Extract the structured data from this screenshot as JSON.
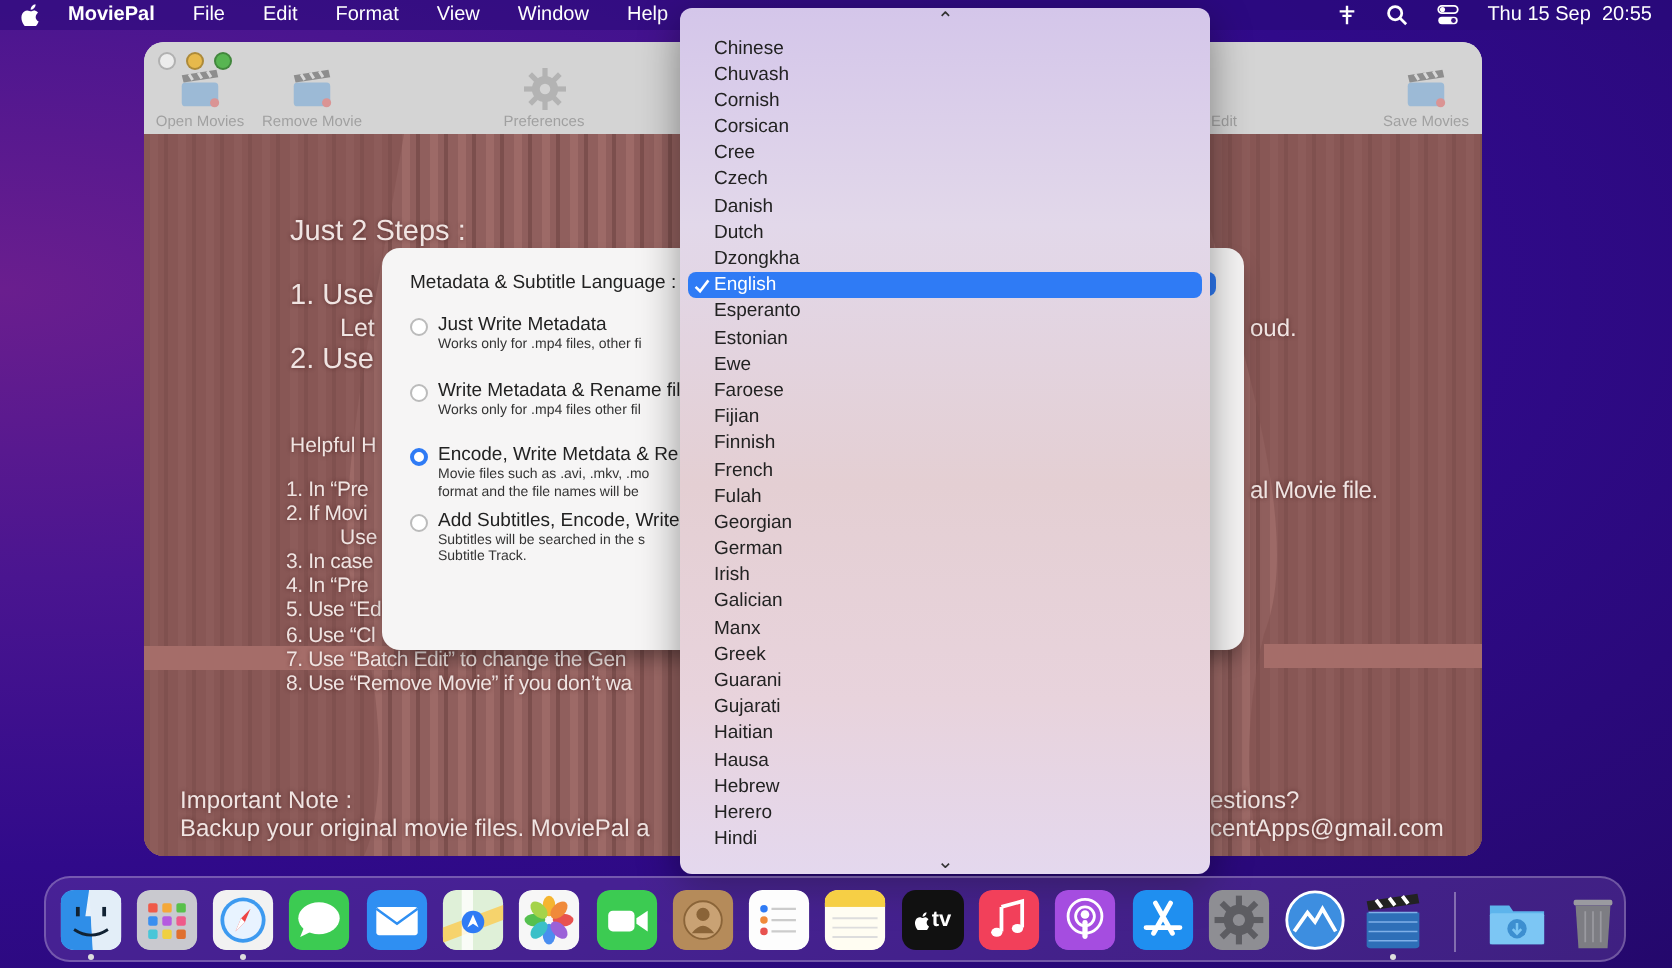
{
  "menu_bar": {
    "app_name": "MoviePal",
    "menus": [
      "File",
      "Edit",
      "Format",
      "View",
      "Window",
      "Help"
    ],
    "clock": "Thu 15 Sep  20:55"
  },
  "window": {
    "toolbar": [
      {
        "kind": "movie",
        "label": "Open Movies"
      },
      {
        "kind": "movie",
        "label": "Remove Movie"
      },
      {
        "kind": "settings",
        "label": "Preferences"
      },
      {
        "kind": "partial",
        "label": "Edit"
      },
      {
        "kind": "movie",
        "label": "Save Movies"
      }
    ],
    "help_text": [
      {
        "kind": "heading",
        "text": "Just 2 Steps :"
      },
      {
        "kind": "step",
        "text": "1. Use"
      },
      {
        "kind": "sub",
        "text": "Let",
        "right": "oud."
      },
      {
        "kind": "step",
        "text": "2. Use"
      },
      {
        "kind": "subheading",
        "text": "Helpful H"
      },
      {
        "kind": "item",
        "text": "1. In “Pre",
        "right": "al Movie file."
      },
      {
        "kind": "item",
        "text": "2. If Movi"
      },
      {
        "kind": "subitem",
        "text": "Use"
      },
      {
        "kind": "item",
        "text": "3. In case"
      },
      {
        "kind": "item",
        "text": "4. In “Pre"
      },
      {
        "kind": "item",
        "text": "5. Use “Ed"
      },
      {
        "kind": "item",
        "text": "6. Use “Cl"
      },
      {
        "kind": "item",
        "text": "7. Use “Batch Edit” to change the Gen"
      },
      {
        "kind": "item",
        "text": "8. Use “Remove Movie” if you don’t wa"
      },
      {
        "kind": "note-title",
        "text": "Important Note :",
        "right": "estions?"
      },
      {
        "kind": "note",
        "text": "Backup your original movie files. MoviePal a",
        "right": "centApps@gmail.com"
      }
    ]
  },
  "sheet": {
    "label": "Metadata & Subtitle Language :",
    "options": [
      {
        "title": "Just Write Metadata",
        "details": [
          "Works only for .mp4 files, other fi"
        ],
        "selected": false
      },
      {
        "title": "Write Metadata & Rename fil",
        "details": [
          "Works only for .mp4 files other fil"
        ],
        "selected": false
      },
      {
        "title": "Encode, Write Metdata & Re",
        "details": [
          "Movie files such as .avi, .mkv, .mo",
          "format and the file names will be"
        ],
        "selected": true
      },
      {
        "title": "Add Subtitles, Encode, Write",
        "details": [
          "Subtitles will be searched in the s",
          "Subtitle Track."
        ],
        "selected": false
      }
    ]
  },
  "language_menu": {
    "scroll_up": "⌃",
    "scroll_down": "⌄",
    "items": [
      {
        "label": "Chinese",
        "selected": false
      },
      {
        "label": "Chuvash",
        "selected": false
      },
      {
        "label": "Cornish",
        "selected": false
      },
      {
        "label": "Corsican",
        "selected": false
      },
      {
        "label": "Cree",
        "selected": false
      },
      {
        "label": "Czech",
        "selected": false
      },
      {
        "label": "Danish",
        "selected": false
      },
      {
        "label": "Dutch",
        "selected": false
      },
      {
        "label": "Dzongkha",
        "selected": false
      },
      {
        "label": "English",
        "selected": true
      },
      {
        "label": "Esperanto",
        "selected": false
      },
      {
        "label": "Estonian",
        "selected": false
      },
      {
        "label": "Ewe",
        "selected": false
      },
      {
        "label": "Faroese",
        "selected": false
      },
      {
        "label": "Fijian",
        "selected": false
      },
      {
        "label": "Finnish",
        "selected": false
      },
      {
        "label": "French",
        "selected": false
      },
      {
        "label": "Fulah",
        "selected": false
      },
      {
        "label": "Georgian",
        "selected": false
      },
      {
        "label": "German",
        "selected": false
      },
      {
        "label": "Irish",
        "selected": false
      },
      {
        "label": "Galician",
        "selected": false
      },
      {
        "label": "Manx",
        "selected": false
      },
      {
        "label": "Greek",
        "selected": false
      },
      {
        "label": "Guarani",
        "selected": false
      },
      {
        "label": "Gujarati",
        "selected": false
      },
      {
        "label": "Haitian",
        "selected": false
      },
      {
        "label": "Hausa",
        "selected": false
      },
      {
        "label": "Hebrew",
        "selected": false
      },
      {
        "label": "Herero",
        "selected": false
      },
      {
        "label": "Hindi",
        "selected": false
      }
    ]
  },
  "dock": {
    "apps": [
      {
        "kind": "finder",
        "running": true
      },
      {
        "kind": "launchpad",
        "running": false
      },
      {
        "kind": "safari",
        "running": true
      },
      {
        "kind": "messages",
        "running": false
      },
      {
        "kind": "mail",
        "running": false
      },
      {
        "kind": "maps",
        "running": false
      },
      {
        "kind": "photos",
        "running": false
      },
      {
        "kind": "facetime",
        "running": false
      },
      {
        "kind": "contacts",
        "running": false
      },
      {
        "kind": "reminders",
        "running": false
      },
      {
        "kind": "notes",
        "running": false
      },
      {
        "kind": "tv",
        "label": "tv",
        "running": false
      },
      {
        "kind": "music",
        "running": false
      },
      {
        "kind": "podcasts",
        "running": false
      },
      {
        "kind": "appstore",
        "running": false
      },
      {
        "kind": "settings",
        "running": false
      },
      {
        "kind": "mountain",
        "running": false
      },
      {
        "kind": "moviepal",
        "running": true
      }
    ],
    "stack": [
      {
        "kind": "downloads"
      },
      {
        "kind": "trash"
      }
    ]
  }
}
